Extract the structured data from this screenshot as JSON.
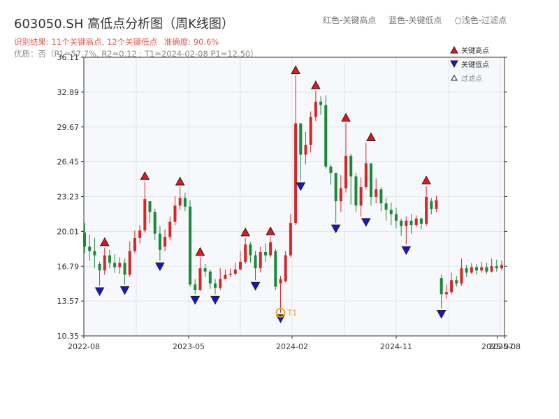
{
  "header": {
    "title": "603050.SH 高低点分析图（周K线图）",
    "legend_red": "红色-关键高点",
    "legend_blue": "蓝色-关键低点",
    "legend_light": "○浅色-过滤点",
    "result_label": "识别结果: 11个关键高点, 12个关键低点",
    "accuracy": "准确度: 90.6%",
    "quality": "优质：否（P1=57.7%, R2=0.12 ; T1=2024-02-08 P1=12.50）"
  },
  "colors": {
    "up": "#d62728",
    "down": "#1a8a3a",
    "high_marker": "#e8141c",
    "low_marker": "#1414d8",
    "t1": "#f5a623",
    "plot_bg": "#f6f8fb",
    "grid": "#e2e6ec"
  },
  "chart_data": {
    "type": "candlestick",
    "title": "603050.SH 高低点分析图（周K线图）",
    "ylim": [
      10.35,
      36.11
    ],
    "yticks": [
      "10.35",
      "13.57",
      "16.79",
      "20.01",
      "23.23",
      "26.45",
      "29.67",
      "32.89",
      "36.11"
    ],
    "xticks": [
      "2022-08",
      "2023-05",
      "2024-02",
      "2024-11",
      "2025-07",
      "2025-08"
    ],
    "legend": [
      "关键高点",
      "关键低点",
      "过滤点"
    ],
    "annotation": "T1",
    "key_highs": [
      {
        "i": 4,
        "value": 18.5
      },
      {
        "i": 12,
        "value": 24.6
      },
      {
        "i": 19,
        "value": 24.1
      },
      {
        "i": 23,
        "value": 17.6
      },
      {
        "i": 32,
        "value": 19.4
      },
      {
        "i": 37,
        "value": 19.5
      },
      {
        "i": 42,
        "value": 34.4
      },
      {
        "i": 46,
        "value": 33.0
      },
      {
        "i": 52,
        "value": 30.0
      },
      {
        "i": 57,
        "value": 28.2
      },
      {
        "i": 68,
        "value": 24.2
      }
    ],
    "key_lows": [
      {
        "i": 3,
        "value": 15.0
      },
      {
        "i": 8,
        "value": 15.1
      },
      {
        "i": 15,
        "value": 17.3
      },
      {
        "i": 22,
        "value": 14.2
      },
      {
        "i": 26,
        "value": 14.2
      },
      {
        "i": 34,
        "value": 15.5
      },
      {
        "i": 39,
        "value": 12.5
      },
      {
        "i": 43,
        "value": 24.7
      },
      {
        "i": 50,
        "value": 20.8
      },
      {
        "i": 56,
        "value": 21.4
      },
      {
        "i": 64,
        "value": 18.8
      },
      {
        "i": 71,
        "value": 12.9
      }
    ],
    "t1": {
      "i": 39,
      "value": 12.5
    },
    "candles": [
      [
        19.9,
        18.6,
        20.8,
        18.0
      ],
      [
        18.6,
        18.2,
        19.7,
        17.3
      ],
      [
        18.2,
        17.8,
        19.4,
        16.6
      ],
      [
        17.0,
        16.4,
        17.2,
        15.0
      ],
      [
        16.4,
        17.8,
        18.5,
        16.0
      ],
      [
        17.8,
        17.1,
        18.3,
        16.6
      ],
      [
        17.1,
        16.7,
        17.9,
        16.2
      ],
      [
        16.7,
        17.1,
        17.6,
        16.1
      ],
      [
        17.1,
        16.0,
        17.5,
        15.1
      ],
      [
        16.0,
        18.2,
        19.1,
        15.8
      ],
      [
        18.2,
        19.4,
        20.1,
        18.0
      ],
      [
        19.4,
        20.1,
        20.6,
        18.9
      ],
      [
        20.1,
        23.0,
        24.6,
        19.9
      ],
      [
        22.8,
        21.8,
        22.6,
        20.8
      ],
      [
        21.8,
        19.8,
        22.1,
        19.2
      ],
      [
        19.8,
        18.3,
        20.5,
        17.3
      ],
      [
        18.6,
        19.5,
        20.2,
        18.2
      ],
      [
        19.5,
        20.9,
        21.4,
        19.2
      ],
      [
        20.9,
        22.4,
        23.3,
        20.6
      ],
      [
        22.4,
        23.1,
        24.1,
        22.0
      ],
      [
        23.1,
        22.3,
        23.6,
        21.9
      ],
      [
        22.3,
        15.1,
        22.9,
        14.9
      ],
      [
        15.1,
        14.6,
        15.6,
        14.2
      ],
      [
        14.6,
        16.6,
        17.6,
        14.5
      ],
      [
        16.6,
        16.3,
        17.0,
        15.8
      ],
      [
        16.3,
        15.2,
        16.5,
        14.7
      ],
      [
        15.2,
        14.8,
        15.6,
        14.2
      ],
      [
        14.8,
        15.6,
        16.6,
        14.6
      ],
      [
        15.6,
        16.0,
        16.5,
        15.6
      ],
      [
        16.0,
        16.1,
        16.6,
        15.8
      ],
      [
        16.1,
        16.5,
        17.1,
        16.0
      ],
      [
        16.5,
        17.2,
        18.2,
        16.4
      ],
      [
        17.2,
        18.8,
        19.4,
        17.0
      ],
      [
        18.8,
        17.8,
        19.0,
        17.1
      ],
      [
        17.8,
        16.6,
        18.2,
        15.5
      ],
      [
        16.6,
        18.1,
        18.6,
        16.2
      ],
      [
        18.1,
        17.8,
        18.9,
        17.2
      ],
      [
        17.8,
        19.0,
        19.5,
        17.6
      ],
      [
        18.2,
        14.9,
        18.4,
        14.6
      ],
      [
        15.2,
        15.6,
        15.9,
        12.5
      ],
      [
        15.4,
        17.8,
        18.2,
        15.3
      ],
      [
        17.8,
        20.8,
        21.6,
        17.6
      ],
      [
        20.8,
        30.0,
        34.4,
        20.6
      ],
      [
        30.0,
        27.1,
        28.1,
        24.7
      ],
      [
        27.1,
        28.0,
        29.2,
        26.2
      ],
      [
        28.0,
        30.6,
        31.1,
        27.3
      ],
      [
        30.6,
        32.0,
        33.0,
        30.2
      ],
      [
        32.0,
        31.7,
        32.5,
        30.8
      ],
      [
        31.7,
        26.0,
        32.6,
        25.8
      ],
      [
        26.0,
        25.4,
        26.2,
        24.3
      ],
      [
        25.4,
        22.8,
        25.0,
        20.8
      ],
      [
        22.8,
        24.0,
        25.2,
        21.8
      ],
      [
        24.0,
        27.0,
        30.0,
        23.6
      ],
      [
        27.0,
        25.1,
        27.2,
        22.5
      ],
      [
        25.1,
        22.4,
        25.4,
        21.8
      ],
      [
        22.4,
        24.1,
        25.0,
        21.4
      ],
      [
        24.1,
        26.3,
        28.2,
        23.9
      ],
      [
        26.3,
        23.2,
        25.3,
        22.4
      ],
      [
        23.2,
        23.9,
        24.9,
        22.6
      ],
      [
        23.9,
        22.6,
        24.1,
        21.9
      ],
      [
        22.6,
        22.0,
        23.1,
        21.0
      ],
      [
        22.0,
        21.6,
        22.7,
        20.6
      ],
      [
        21.6,
        21.0,
        22.2,
        20.3
      ],
      [
        21.0,
        20.5,
        21.2,
        19.6
      ],
      [
        20.5,
        21.0,
        21.4,
        18.8
      ],
      [
        21.0,
        20.6,
        21.6,
        19.8
      ],
      [
        20.6,
        21.2,
        21.5,
        20.4
      ],
      [
        21.2,
        20.7,
        21.3,
        20.2
      ],
      [
        20.7,
        23.2,
        24.2,
        20.5
      ],
      [
        22.8,
        22.1,
        23.1,
        21.6
      ],
      [
        22.1,
        22.9,
        23.3,
        21.8
      ],
      [
        15.7,
        14.2,
        16.0,
        12.9
      ],
      [
        14.2,
        14.4,
        15.1,
        13.8
      ],
      [
        14.4,
        15.5,
        16.2,
        14.2
      ],
      [
        15.5,
        15.2,
        15.9,
        14.9
      ],
      [
        15.2,
        16.6,
        17.5,
        15.0
      ],
      [
        16.6,
        16.2,
        16.9,
        15.8
      ],
      [
        16.2,
        16.7,
        17.1,
        16.1
      ],
      [
        16.7,
        16.4,
        17.0,
        16.0
      ],
      [
        16.4,
        16.7,
        17.2,
        16.2
      ],
      [
        16.7,
        16.3,
        17.1,
        16.1
      ],
      [
        16.3,
        16.8,
        17.5,
        16.2
      ],
      [
        16.8,
        16.6,
        17.4,
        16.3
      ],
      [
        16.6,
        16.9,
        17.3,
        16.4
      ]
    ]
  }
}
